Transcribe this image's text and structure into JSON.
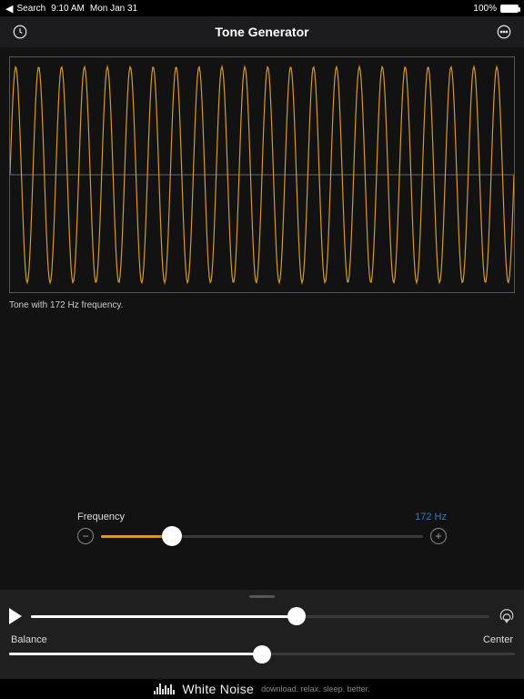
{
  "status": {
    "back_label": "Search",
    "time": "9:10 AM",
    "date": "Mon Jan 31",
    "battery_percent": "100%"
  },
  "header": {
    "title": "Tone Generator"
  },
  "wave": {
    "description": "Tone with 172 Hz frequency.",
    "color": "#d49a2a",
    "cycles": 22
  },
  "frequency": {
    "label": "Frequency",
    "value_display": "172 Hz",
    "position_fraction": 0.22
  },
  "playback": {
    "volume_fraction": 0.58,
    "balance_label": "Balance",
    "balance_right_label": "Center",
    "balance_fraction": 0.5
  },
  "ad": {
    "brand": "White Noise",
    "tagline": "download. relax. sleep. better."
  }
}
